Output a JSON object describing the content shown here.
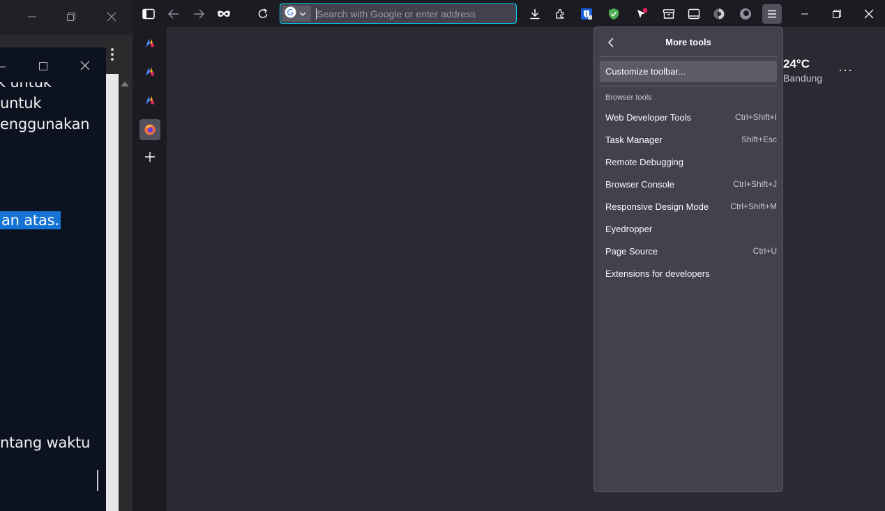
{
  "background_window": {
    "text_lines": [
      "k untuk",
      "untuk",
      "enggunakan",
      "an atas.",
      "ntang waktu"
    ]
  },
  "toolbar": {
    "search_placeholder": "Search with Google or enter address"
  },
  "weather": {
    "temperature": "24°C",
    "city": "Bandung",
    "more": "···"
  },
  "panel": {
    "title": "More tools",
    "customize_label": "Customize toolbar...",
    "section_label": "Browser tools",
    "items": [
      {
        "label": "Web Developer Tools",
        "shortcut": "Ctrl+Shift+I"
      },
      {
        "label": "Task Manager",
        "shortcut": "Shift+Esc"
      },
      {
        "label": "Remote Debugging",
        "shortcut": ""
      },
      {
        "label": "Browser Console",
        "shortcut": "Ctrl+Shift+J"
      },
      {
        "label": "Responsive Design Mode",
        "shortcut": "Ctrl+Shift+M"
      },
      {
        "label": "Eyedropper",
        "shortcut": ""
      },
      {
        "label": "Page Source",
        "shortcut": "Ctrl+U"
      },
      {
        "label": "Extensions for developers",
        "shortcut": ""
      }
    ]
  },
  "colors": {
    "accent_focus": "#00ddff",
    "panel_bg": "#42414d",
    "highlight": "#1473d4"
  }
}
